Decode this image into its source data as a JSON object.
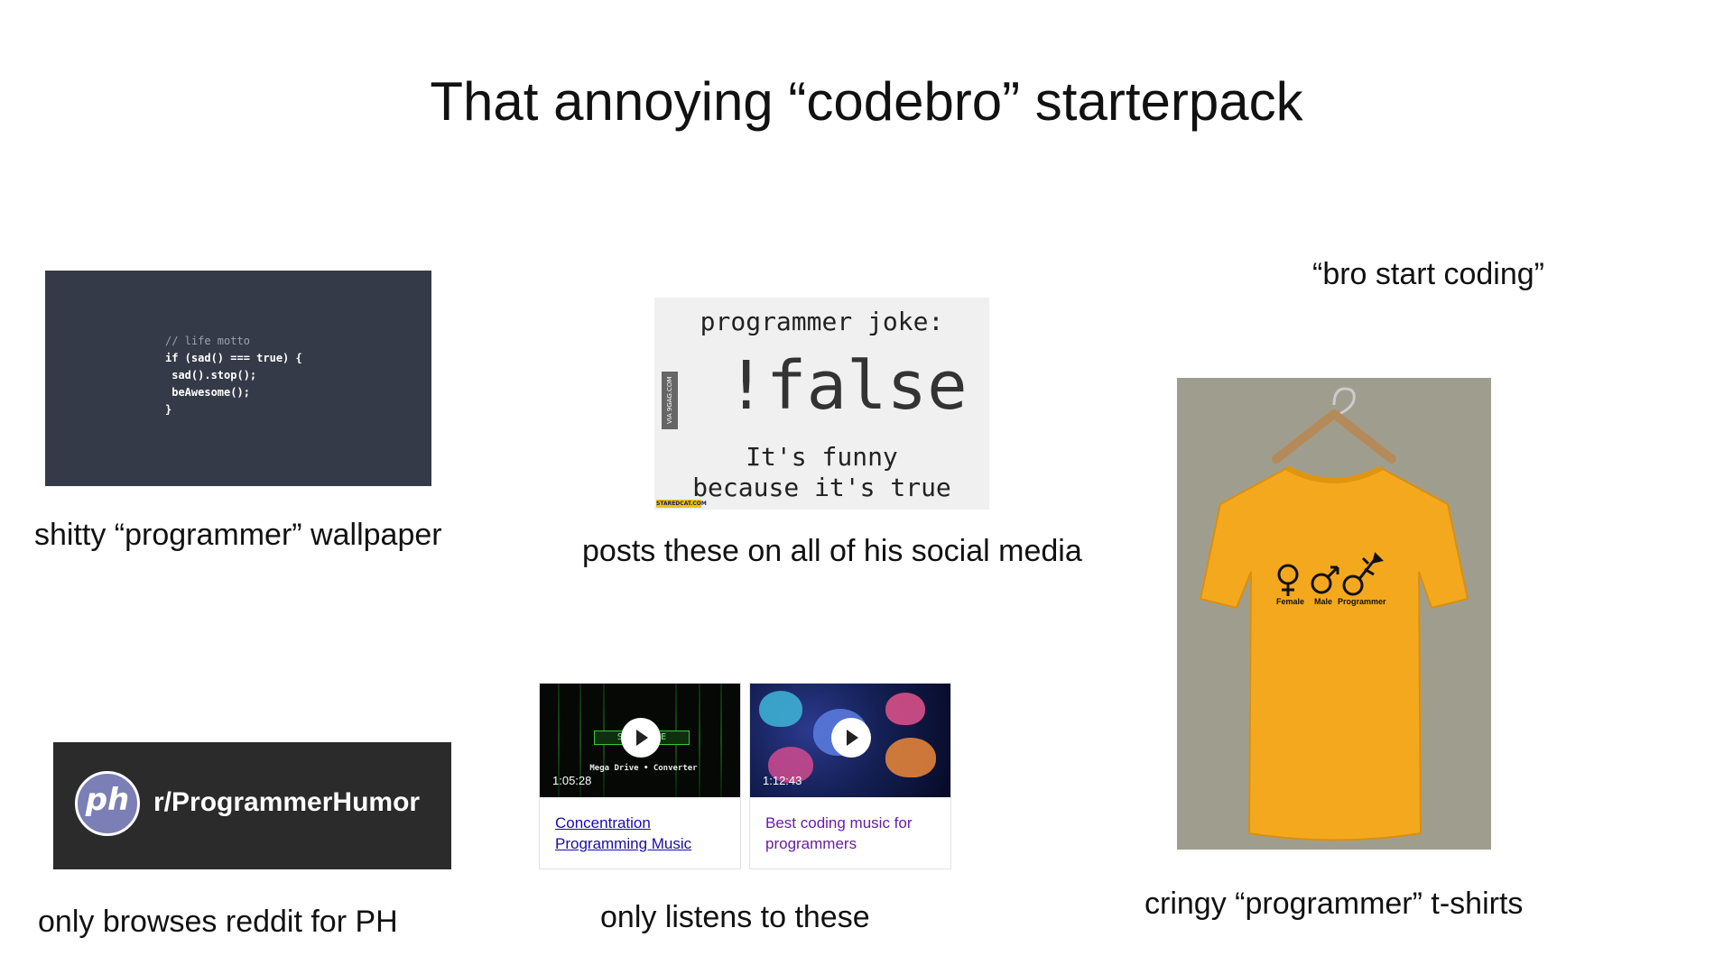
{
  "title": "That annoying “codebro” starterpack",
  "panels": {
    "wallpaper": {
      "caption": "shitty “programmer” wallpaper",
      "code_comment": "// life motto",
      "code_lines": "if (sad() === true) {\n sad().stop();\n beAwesome();\n}"
    },
    "joke": {
      "caption": "posts these on all of his social media",
      "line1": "programmer joke:",
      "line2": "!false",
      "line3": "It's funny",
      "line4": "because it's true",
      "side_label": "VIA 9GAG.COM",
      "stamp": "STAREDCAT.COM"
    },
    "reddit": {
      "caption": "only browses reddit for PH",
      "logo_text": "ph",
      "subreddit": "r/ProgrammerHumor"
    },
    "videos": {
      "caption": "only listens to these",
      "items": [
        {
          "title": "Concentration Programming Music",
          "duration": "1:05:28",
          "thumb_box": "SYST  LURE",
          "thumb_sub": "Mega Drive • Converter"
        },
        {
          "title": "Best coding music for programmers",
          "duration": "1:12:43"
        }
      ]
    },
    "tshirt": {
      "quote": "“bro start coding”",
      "caption": "cringy “programmer” t-shirts",
      "labels": [
        "Female",
        "Male",
        "Programmer"
      ],
      "shirt_color": "#f4a81d",
      "background_color": "#9f9e8e"
    }
  }
}
